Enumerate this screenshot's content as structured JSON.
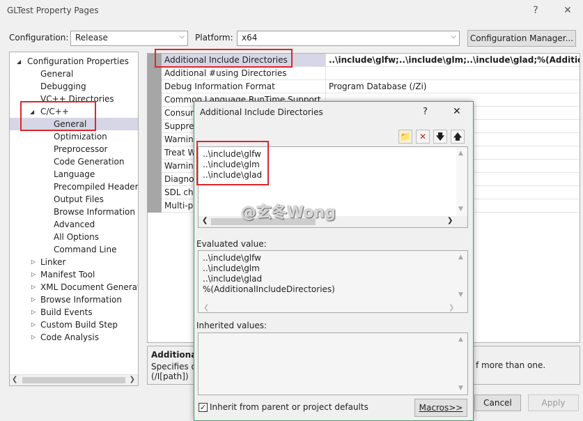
{
  "window": {
    "title": "GLTest Property Pages",
    "help": "?",
    "close": "✕"
  },
  "config": {
    "configuration_label": "Configuration:",
    "configuration_value": "Release",
    "platform_label": "Platform:",
    "platform_value": "x64",
    "manager_button": "Configuration Manager..."
  },
  "tree": {
    "items": [
      {
        "label": "Configuration Properties"
      },
      {
        "label": "General"
      },
      {
        "label": "Debugging"
      },
      {
        "label": "VC++ Directories"
      },
      {
        "label": "C/C++"
      },
      {
        "label": "General"
      },
      {
        "label": "Optimization"
      },
      {
        "label": "Preprocessor"
      },
      {
        "label": "Code Generation"
      },
      {
        "label": "Language"
      },
      {
        "label": "Precompiled Headers"
      },
      {
        "label": "Output Files"
      },
      {
        "label": "Browse Information"
      },
      {
        "label": "Advanced"
      },
      {
        "label": "All Options"
      },
      {
        "label": "Command Line"
      },
      {
        "label": "Linker"
      },
      {
        "label": "Manifest Tool"
      },
      {
        "label": "XML Document Generator"
      },
      {
        "label": "Browse Information"
      },
      {
        "label": "Build Events"
      },
      {
        "label": "Custom Build Step"
      },
      {
        "label": "Code Analysis"
      }
    ]
  },
  "grid": {
    "rows": [
      {
        "name": "Additional Include Directories",
        "value": "..\\include\\glfw;..\\include\\glm;..\\include\\glad;%(AdditionalInclude"
      },
      {
        "name": "Additional #using Directories",
        "value": ""
      },
      {
        "name": "Debug Information Format",
        "value": "Program Database (/Zi)"
      },
      {
        "name": "Common Language RunTime Support",
        "value": ""
      },
      {
        "name": "Consum",
        "value": ""
      },
      {
        "name": "Suppres",
        "value": ""
      },
      {
        "name": "Warning",
        "value": ""
      },
      {
        "name": "Treat W",
        "value": ""
      },
      {
        "name": "Warning",
        "value": ""
      },
      {
        "name": "Diagnos",
        "value": ""
      },
      {
        "name": "SDL che",
        "value": ""
      },
      {
        "name": "Multi-p",
        "value": ""
      }
    ]
  },
  "description": {
    "title": "Additional I",
    "text_line1": "Specifies or",
    "text_line1_right": "f more than one.",
    "text_line2": "(/I[path])"
  },
  "footer": {
    "cancel": "Cancel",
    "apply": "Apply"
  },
  "dialog": {
    "title": "Additional Include Directories",
    "help": "?",
    "close": "✕",
    "tools": {
      "new_icon": "folder-new-icon",
      "delete_icon": "delete-icon",
      "down_icon": "arrow-down-icon",
      "up_icon": "arrow-up-icon"
    },
    "entries": [
      "..\\include\\glfw",
      "..\\include\\glm",
      "..\\include\\glad"
    ],
    "evaluated_label": "Evaluated value:",
    "evaluated": [
      "..\\include\\glfw",
      "..\\include\\glm",
      "..\\include\\glad",
      "%(AdditionalIncludeDirectories)"
    ],
    "inherited_label": "Inherited values:",
    "inherit_checkbox": "Inherit from parent or project defaults",
    "macros_button": "Macros>>",
    "watermark": "@玄冬Wong"
  },
  "colors": {
    "highlight": "#e0242a",
    "selection": "#d6d6e6",
    "dialog_border": "#4c9a6a"
  }
}
